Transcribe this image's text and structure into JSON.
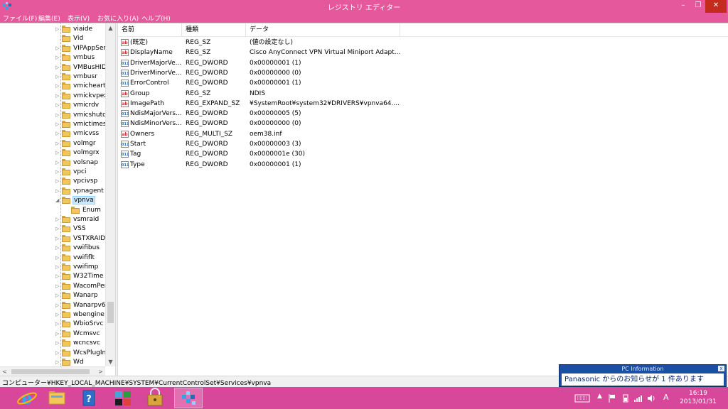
{
  "window": {
    "title": "レジストリ エディター",
    "minimize_glyph": "–",
    "maximize_glyph": "❐",
    "close_glyph": "✕"
  },
  "menu": [
    "ファイル(F)",
    "編集(E)",
    "表示(V)",
    "お気に入り(A)",
    "ヘルプ(H)"
  ],
  "tree": {
    "items": [
      {
        "label": "viaide",
        "arrow": "▷"
      },
      {
        "label": "Vid",
        "arrow": ""
      },
      {
        "label": "VIPAppSer",
        "arrow": "▷"
      },
      {
        "label": "vmbus",
        "arrow": "▷"
      },
      {
        "label": "VMBusHID",
        "arrow": "▷"
      },
      {
        "label": "vmbusr",
        "arrow": "▷"
      },
      {
        "label": "vmicheart",
        "arrow": "▷"
      },
      {
        "label": "vmickvpex",
        "arrow": "▷"
      },
      {
        "label": "vmicrdv",
        "arrow": "▷"
      },
      {
        "label": "vmicshutd",
        "arrow": "▷"
      },
      {
        "label": "vmictimes",
        "arrow": "▷"
      },
      {
        "label": "vmicvss",
        "arrow": "▷"
      },
      {
        "label": "volmgr",
        "arrow": "▷"
      },
      {
        "label": "volmgrx",
        "arrow": "▷"
      },
      {
        "label": "volsnap",
        "arrow": "▷"
      },
      {
        "label": "vpci",
        "arrow": "▷"
      },
      {
        "label": "vpcivsp",
        "arrow": "▷"
      },
      {
        "label": "vpnagent",
        "arrow": "▷"
      },
      {
        "label": "vpnva",
        "arrow": "◢",
        "selected": true
      },
      {
        "label": "Enum",
        "arrow": "",
        "child": true
      },
      {
        "label": "vsmraid",
        "arrow": "▷"
      },
      {
        "label": "VSS",
        "arrow": "▷"
      },
      {
        "label": "VSTXRAID",
        "arrow": "▷"
      },
      {
        "label": "vwifibus",
        "arrow": "▷"
      },
      {
        "label": "vwififlt",
        "arrow": "▷"
      },
      {
        "label": "vwifimp",
        "arrow": "▷"
      },
      {
        "label": "W32Time",
        "arrow": "▷"
      },
      {
        "label": "WacomPen",
        "arrow": "▷"
      },
      {
        "label": "Wanarp",
        "arrow": "▷"
      },
      {
        "label": "Wanarpv6",
        "arrow": "▷"
      },
      {
        "label": "wbengine",
        "arrow": "▷"
      },
      {
        "label": "WbioSrvc",
        "arrow": "▷"
      },
      {
        "label": "Wcmsvc",
        "arrow": "▷"
      },
      {
        "label": "wcncsvc",
        "arrow": "▷"
      },
      {
        "label": "WcsPlugIn",
        "arrow": "▷"
      },
      {
        "label": "Wd",
        "arrow": "▷"
      }
    ],
    "scroll_up": "▲",
    "scroll_down": "▼",
    "scroll_left": "<",
    "scroll_right": ">"
  },
  "list": {
    "columns": [
      "名前",
      "種類",
      "データ"
    ],
    "rows": [
      {
        "icon": "ab",
        "name": "(既定)",
        "type": "REG_SZ",
        "data": "(値の設定なし)"
      },
      {
        "icon": "ab",
        "name": "DisplayName",
        "type": "REG_SZ",
        "data": "Cisco AnyConnect VPN Virtual Miniport Adapt..."
      },
      {
        "icon": "bin",
        "name": "DriverMajorVe...",
        "type": "REG_DWORD",
        "data": "0x00000001 (1)"
      },
      {
        "icon": "bin",
        "name": "DriverMinorVe...",
        "type": "REG_DWORD",
        "data": "0x00000000 (0)"
      },
      {
        "icon": "bin",
        "name": "ErrorControl",
        "type": "REG_DWORD",
        "data": "0x00000001 (1)"
      },
      {
        "icon": "ab",
        "name": "Group",
        "type": "REG_SZ",
        "data": "NDIS"
      },
      {
        "icon": "ab",
        "name": "ImagePath",
        "type": "REG_EXPAND_SZ",
        "data": "¥SystemRoot¥system32¥DRIVERS¥vpnva64...."
      },
      {
        "icon": "bin",
        "name": "NdisMajorVers...",
        "type": "REG_DWORD",
        "data": "0x00000005 (5)"
      },
      {
        "icon": "bin",
        "name": "NdisMinorVers...",
        "type": "REG_DWORD",
        "data": "0x00000000 (0)"
      },
      {
        "icon": "ab",
        "name": "Owners",
        "type": "REG_MULTI_SZ",
        "data": "oem38.inf"
      },
      {
        "icon": "bin",
        "name": "Start",
        "type": "REG_DWORD",
        "data": "0x00000003 (3)"
      },
      {
        "icon": "bin",
        "name": "Tag",
        "type": "REG_DWORD",
        "data": "0x0000001e (30)"
      },
      {
        "icon": "bin",
        "name": "Type",
        "type": "REG_DWORD",
        "data": "0x00000001 (1)"
      }
    ]
  },
  "status": {
    "path": "コンピューター¥HKEY_LOCAL_MACHINE¥SYSTEM¥CurrentControlSet¥Services¥vpnva"
  },
  "notification": {
    "title": "PC Information",
    "close_glyph": "x",
    "message": "Panasonic からのお知らせが 1 件あります"
  },
  "taskbar": {
    "apps": [
      "internet-explorer",
      "file-explorer",
      "help",
      "store-tiles",
      "security-lock",
      "registry-editor"
    ],
    "tray_ime": "A",
    "time": "16:19",
    "date": "2013/01/31"
  },
  "colors": {
    "accent": "#e5589c",
    "taskbar": "#d8489a",
    "selection": "#cce8ff",
    "notify": "#1c4fa3"
  }
}
